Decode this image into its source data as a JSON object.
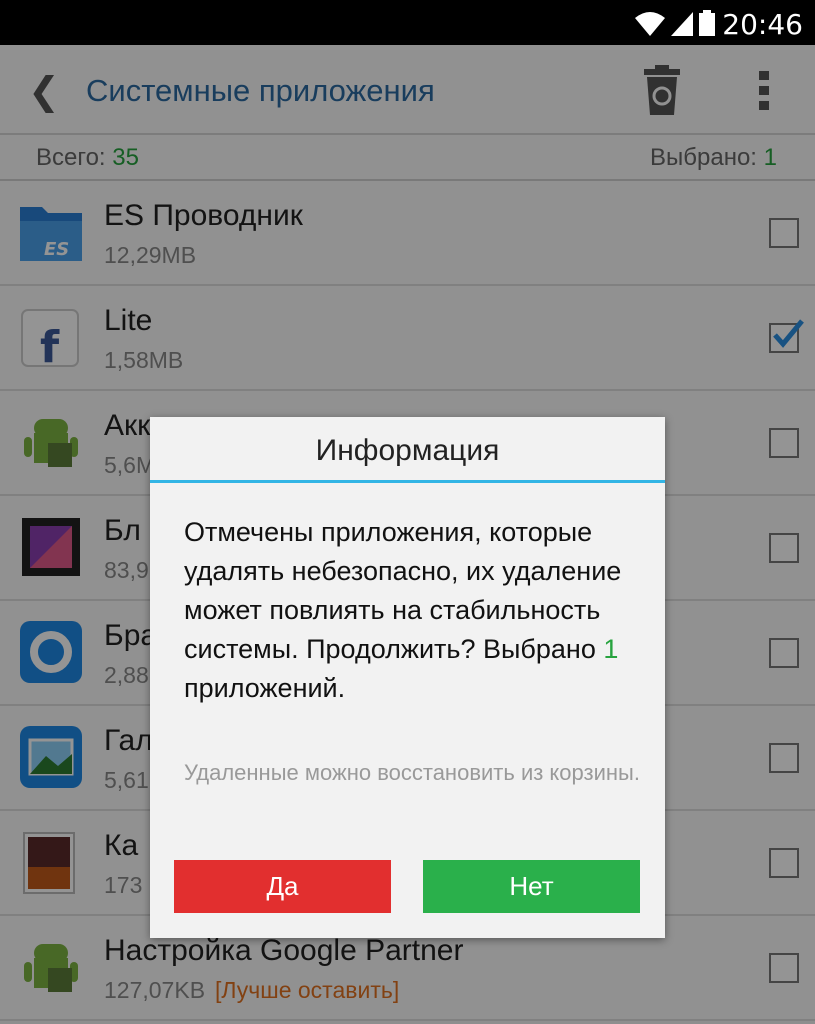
{
  "status_bar": {
    "time": "20:46"
  },
  "header": {
    "title": "Системные приложения",
    "icons": [
      "back-arrow-icon",
      "recycle-bin-icon",
      "overflow-menu-icon"
    ]
  },
  "summary": {
    "total_label": "Всего:",
    "total_count": "35",
    "selected_label": "Выбрано:",
    "selected_count": "1"
  },
  "apps": [
    {
      "name": "ES Проводник",
      "size": "12,29MB",
      "checked": false,
      "icon": "es-explorer-icon"
    },
    {
      "name": "Lite",
      "size": "1,58MB",
      "checked": true,
      "icon": "facebook-icon"
    },
    {
      "name": "Акк",
      "size": "5,6M",
      "checked": false,
      "icon": "android-icon"
    },
    {
      "name": "Бл",
      "size": "83,9",
      "checked": false,
      "icon": "picture-frame-icon"
    },
    {
      "name": "Бра",
      "size": "2,88",
      "checked": false,
      "icon": "browser-icon"
    },
    {
      "name": "Гал",
      "size": "5,61",
      "checked": false,
      "icon": "gallery-icon"
    },
    {
      "name": "Ка",
      "size": "173",
      "checked": false,
      "icon": "wallpaper-icon"
    },
    {
      "name": "Настройка Google Partner",
      "size": "127,07KB",
      "note": "[Лучше оставить]",
      "checked": false,
      "icon": "android-icon"
    }
  ],
  "dialog": {
    "title": "Информация",
    "message": "Отмечены приложения, которые удалять небезопасно, их удаление может повлиять на стабильность системы. Продолжить? Выбрано",
    "count": "1",
    "message_end": "приложений.",
    "subtext": "Удаленные можно восстановить из корзины.",
    "yes_label": "Да",
    "no_label": "Нет"
  },
  "colors": {
    "accent_blue": "#33b5e5",
    "title_blue": "#2c6aa0",
    "count_green": "#27a33f",
    "yes_red": "#e22f2f",
    "no_green": "#2ab04b",
    "note_orange": "#e07020"
  }
}
